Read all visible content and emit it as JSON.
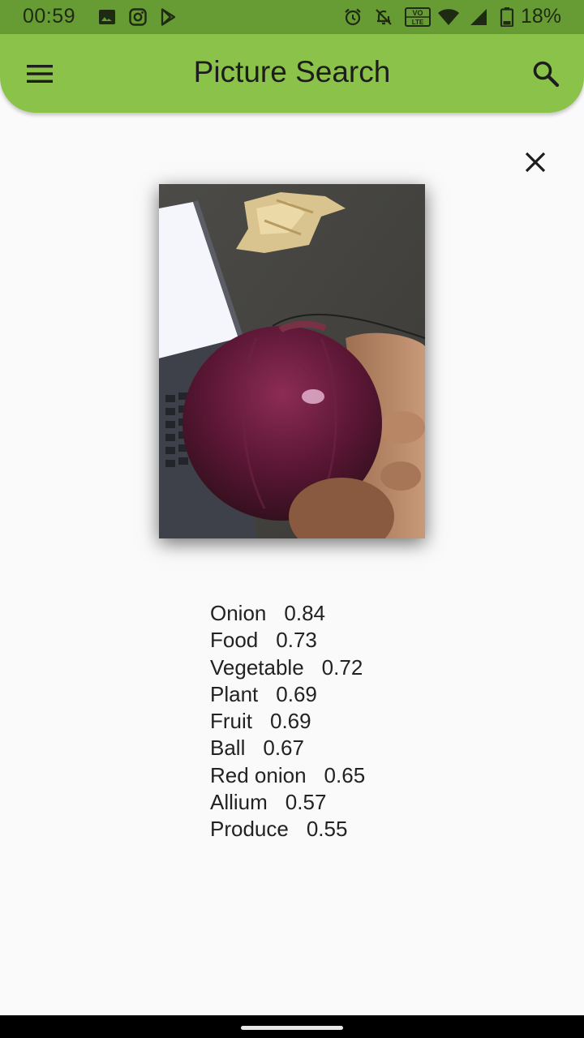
{
  "status_bar": {
    "time": "00:59",
    "battery": "18%",
    "network_badge_top": "VO",
    "network_badge_bottom": "LTE",
    "icons": [
      "image-icon",
      "instagram-icon",
      "play-store-icon",
      "alarm-icon",
      "notifications-off-icon",
      "volte-icon",
      "wifi-icon",
      "signal-icon",
      "battery-icon"
    ]
  },
  "app_bar": {
    "title": "Picture Search",
    "menu_icon": "menu-icon",
    "search_icon": "search-icon"
  },
  "close_icon": "close-icon",
  "labels": [
    {
      "name": "Onion",
      "score": "0.84"
    },
    {
      "name": "Food",
      "score": "0.73"
    },
    {
      "name": "Vegetable",
      "score": "0.72"
    },
    {
      "name": "Plant",
      "score": "0.69"
    },
    {
      "name": "Fruit",
      "score": "0.69"
    },
    {
      "name": "Ball",
      "score": "0.67"
    },
    {
      "name": "Red onion",
      "score": "0.65"
    },
    {
      "name": "Allium",
      "score": "0.57"
    },
    {
      "name": "Produce",
      "score": "0.55"
    }
  ],
  "colors": {
    "status_bar": "#679b33",
    "app_bar": "#8bc34a",
    "background": "#fafafa"
  }
}
